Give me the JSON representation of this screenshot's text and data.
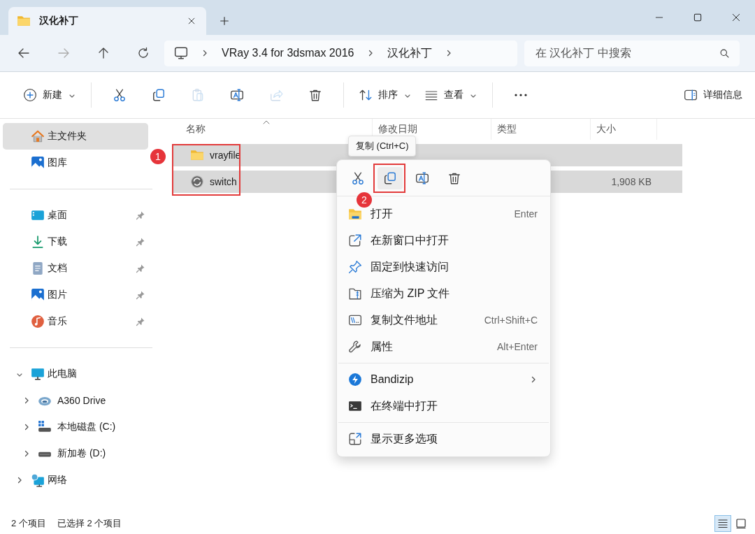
{
  "tabs": [
    {
      "title": "汉化补丁",
      "selected": true
    }
  ],
  "address_bar": {
    "breadcrumbs": [
      "VRay 3.4 for 3dsmax 2016",
      "汉化补丁"
    ]
  },
  "search": {
    "placeholder": "在 汉化补丁 中搜索"
  },
  "toolbar": {
    "items": [
      {
        "kind": "new",
        "label": "新建",
        "disabled": false
      },
      {
        "kind": "cut",
        "disabled": false
      },
      {
        "kind": "copy",
        "disabled": false
      },
      {
        "kind": "paste",
        "disabled": true
      },
      {
        "kind": "rename",
        "disabled": false
      },
      {
        "kind": "share",
        "disabled": true
      },
      {
        "kind": "delete",
        "disabled": false
      },
      {
        "kind": "sort",
        "label": "排序",
        "disabled": false
      },
      {
        "kind": "view",
        "label": "查看",
        "disabled": false
      },
      {
        "kind": "more",
        "disabled": false
      }
    ],
    "details": {
      "label": "详细信息"
    }
  },
  "sidebar": {
    "sections": [
      [
        {
          "label": "主文件夹",
          "kind": "home",
          "selected": true,
          "pinned": false
        },
        {
          "label": "图库",
          "kind": "gallery",
          "selected": false,
          "pinned": false
        }
      ],
      [
        {
          "label": "桌面",
          "kind": "desktop",
          "selected": false,
          "pinned": true
        },
        {
          "label": "下载",
          "kind": "download",
          "selected": false,
          "pinned": true
        },
        {
          "label": "文档",
          "kind": "document",
          "selected": false,
          "pinned": true
        },
        {
          "label": "图片",
          "kind": "gallery",
          "selected": false,
          "pinned": true
        },
        {
          "label": "音乐",
          "kind": "music",
          "selected": false,
          "pinned": true
        }
      ],
      [
        {
          "label": "此电脑",
          "kind": "pc",
          "selected": false,
          "pinned": false,
          "expanded": true,
          "children": [
            {
              "label": "A360 Drive",
              "kind": "cloud",
              "selected": false,
              "pinned": false,
              "expanded": false
            },
            {
              "label": "本地磁盘 (C:)",
              "kind": "sysdrive",
              "selected": false,
              "pinned": false,
              "expanded": false
            },
            {
              "label": "新加卷 (D:)",
              "kind": "drive",
              "selected": false,
              "pinned": false,
              "expanded": false
            }
          ]
        },
        {
          "label": "网络",
          "kind": "network",
          "selected": false,
          "pinned": false,
          "expanded": false
        }
      ]
    ]
  },
  "file_list": {
    "columns": [
      {
        "label": "名称",
        "sorted": true
      },
      {
        "label": "修改日期",
        "sorted": false
      },
      {
        "label": "类型",
        "sorted": false
      },
      {
        "label": "大小",
        "sorted": false
      }
    ],
    "rows": [
      {
        "name": "vrayfile",
        "kind": "folder",
        "selected": true
      },
      {
        "name": "switch",
        "kind": "app",
        "size": "1,908 KB",
        "selected": true
      }
    ],
    "annotation": "1"
  },
  "tooltip": "复制 (Ctrl+C)",
  "context_menu": {
    "actions": [
      {
        "kind": "cut",
        "hovered": false
      },
      {
        "kind": "copy",
        "hovered": true,
        "annotation": "2"
      },
      {
        "kind": "rename",
        "hovered": false
      },
      {
        "kind": "delete",
        "hovered": false
      }
    ],
    "sections": [
      [
        {
          "kind": "open",
          "label": "打开",
          "shortcut": "Enter"
        },
        {
          "kind": "newwindow",
          "label": "在新窗口中打开"
        },
        {
          "kind": "pin",
          "label": "固定到快速访问"
        },
        {
          "kind": "zip",
          "label": "压缩为 ZIP 文件"
        },
        {
          "kind": "path",
          "label": "复制文件地址",
          "shortcut": "Ctrl+Shift+C"
        },
        {
          "kind": "properties",
          "label": "属性",
          "shortcut": "Alt+Enter"
        }
      ],
      [
        {
          "kind": "bandizip",
          "label": "Bandizip",
          "submenu": true
        },
        {
          "kind": "terminal",
          "label": "在终端中打开"
        }
      ],
      [
        {
          "kind": "more",
          "label": "显示更多选项"
        }
      ]
    ]
  },
  "status_bar": {
    "items": [
      "2 个项目",
      "已选择 2 个项目"
    ],
    "views": [
      {
        "kind": "details",
        "selected": true
      },
      {
        "kind": "tiles",
        "selected": false
      }
    ]
  }
}
